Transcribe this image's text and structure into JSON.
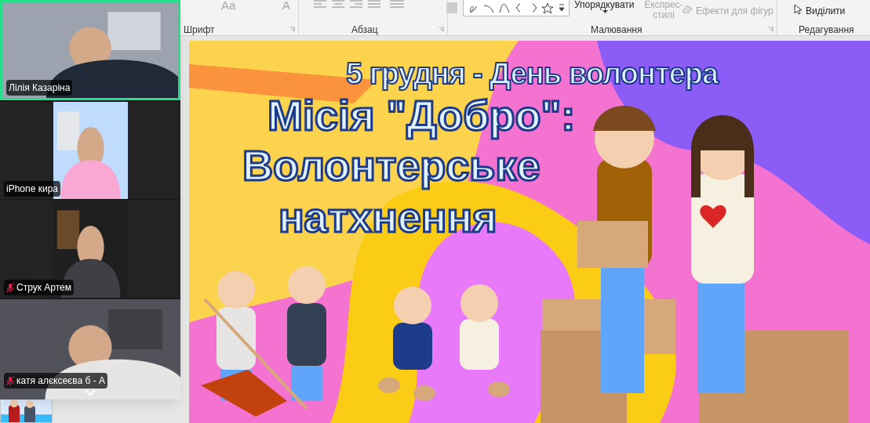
{
  "ribbon": {
    "tools": [
      {
        "label": "Aa",
        "disabled": true
      },
      {
        "label": "A",
        "disabled": true
      }
    ],
    "controls": [
      {
        "label": "Упорядкувати",
        "disabled": false
      },
      {
        "label": "Експрес-стилі",
        "disabled": true
      },
      {
        "label": "Ефекти для фігур",
        "disabled": true
      },
      {
        "label": "Виділити",
        "disabled": false
      }
    ],
    "groups": [
      {
        "label": "Шрифт"
      },
      {
        "label": "Абзац"
      },
      {
        "label": "Малювання"
      },
      {
        "label": "Редагування"
      }
    ]
  },
  "participants": [
    {
      "name": "Лілія Казаріна",
      "muted": false,
      "speaking": true,
      "kind": "wide"
    },
    {
      "name": "iPhone кира",
      "muted": false,
      "speaking": false,
      "kind": "narrow"
    },
    {
      "name": "Струк Артем",
      "muted": true,
      "speaking": false,
      "kind": "narrow"
    },
    {
      "name": "катя алєксеєва б - А",
      "muted": true,
      "speaking": false,
      "kind": "wide"
    }
  ],
  "slide": {
    "date_line": "5 грудня - День волонтера",
    "heading": [
      "Місія \"Добро\":",
      "Волонтерське",
      "натхнення"
    ]
  }
}
